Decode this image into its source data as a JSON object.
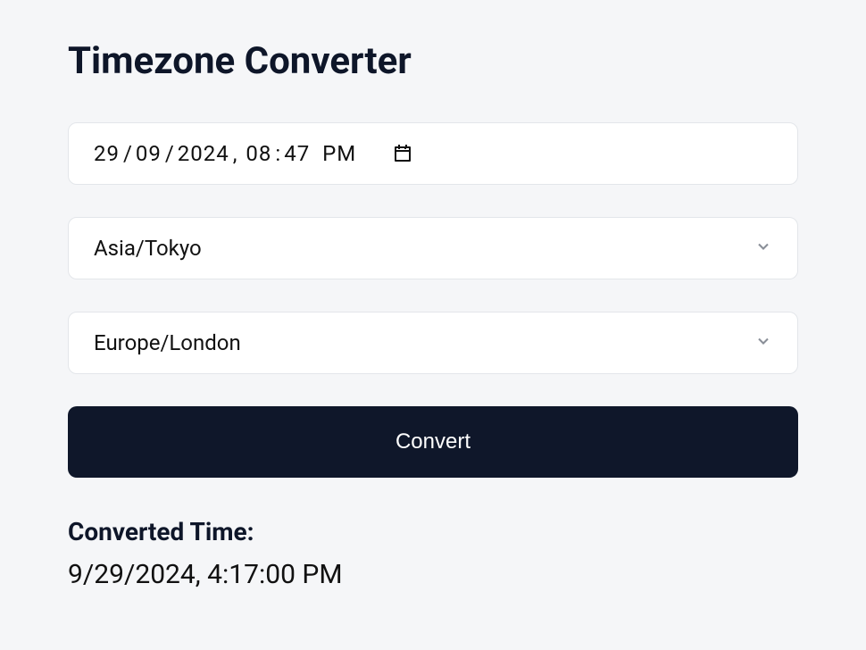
{
  "title": "Timezone Converter",
  "datetime": {
    "day": "29",
    "month": "09",
    "year": "2024",
    "hour": "08",
    "minute": "47",
    "ampm": "PM"
  },
  "from_timezone": {
    "selected": "Asia/Tokyo"
  },
  "to_timezone": {
    "selected": "Europe/London"
  },
  "convert_button_label": "Convert",
  "result": {
    "heading": "Converted Time:",
    "value": "9/29/2024, 4:17:00 PM"
  }
}
